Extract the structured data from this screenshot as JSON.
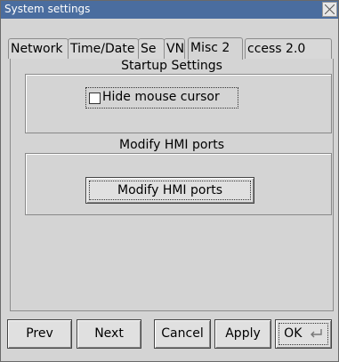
{
  "window": {
    "title": "System settings"
  },
  "tabs": [
    {
      "label": "Network",
      "active": false
    },
    {
      "label": "Time/Date",
      "active": false
    },
    {
      "label": "Se",
      "active": false
    },
    {
      "label": "VN",
      "active": false
    },
    {
      "label": "Misc 2",
      "active": true
    },
    {
      "label": "ccess 2.0",
      "active": false
    }
  ],
  "startup": {
    "heading": "Startup Settings",
    "hide_cursor_label": "Hide mouse cursor",
    "hide_cursor_checked": false
  },
  "hmi": {
    "heading": "Modify HMI ports",
    "button_label": "Modify HMI ports"
  },
  "footer": {
    "prev": "Prev",
    "next": "Next",
    "cancel": "Cancel",
    "apply": "Apply",
    "ok": "OK"
  }
}
